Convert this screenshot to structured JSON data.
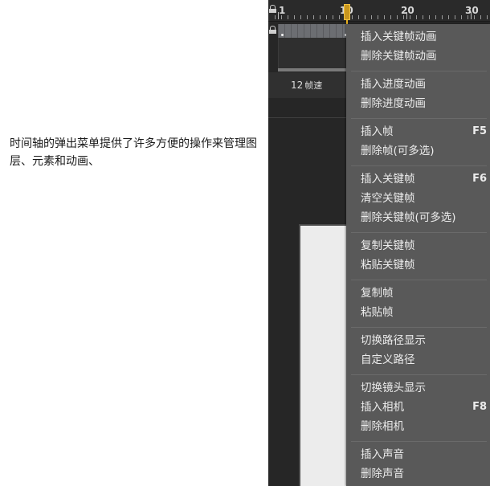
{
  "caption": "时间轴的弹出菜单提供了许多方便的操作来管理图层、元素和动画、",
  "timeline": {
    "ruler_labels": [
      "1",
      "10",
      "20",
      "30"
    ],
    "fps_value": "12",
    "fps_unit": "帧速"
  },
  "menu": {
    "groups": [
      {
        "items": [
          {
            "label": "插入关键帧动画",
            "shortcut": ""
          },
          {
            "label": "删除关键帧动画",
            "shortcut": ""
          }
        ]
      },
      {
        "items": [
          {
            "label": "插入进度动画",
            "shortcut": ""
          },
          {
            "label": "删除进度动画",
            "shortcut": ""
          }
        ]
      },
      {
        "items": [
          {
            "label": "插入帧",
            "shortcut": "F5"
          },
          {
            "label": "删除帧(可多选)",
            "shortcut": ""
          }
        ]
      },
      {
        "items": [
          {
            "label": "插入关键帧",
            "shortcut": "F6"
          },
          {
            "label": "清空关键帧",
            "shortcut": ""
          },
          {
            "label": "删除关键帧(可多选)",
            "shortcut": ""
          }
        ]
      },
      {
        "items": [
          {
            "label": "复制关键帧",
            "shortcut": ""
          },
          {
            "label": "粘贴关键帧",
            "shortcut": ""
          }
        ]
      },
      {
        "items": [
          {
            "label": "复制帧",
            "shortcut": ""
          },
          {
            "label": "粘贴帧",
            "shortcut": ""
          }
        ]
      },
      {
        "items": [
          {
            "label": "切换路径显示",
            "shortcut": ""
          },
          {
            "label": "自定义路径",
            "shortcut": ""
          }
        ]
      },
      {
        "items": [
          {
            "label": "切换镜头显示",
            "shortcut": ""
          },
          {
            "label": "插入相机",
            "shortcut": "F8"
          },
          {
            "label": "删除相机",
            "shortcut": ""
          }
        ]
      },
      {
        "items": [
          {
            "label": "插入声音",
            "shortcut": ""
          },
          {
            "label": "删除声音",
            "shortcut": ""
          }
        ]
      }
    ]
  }
}
